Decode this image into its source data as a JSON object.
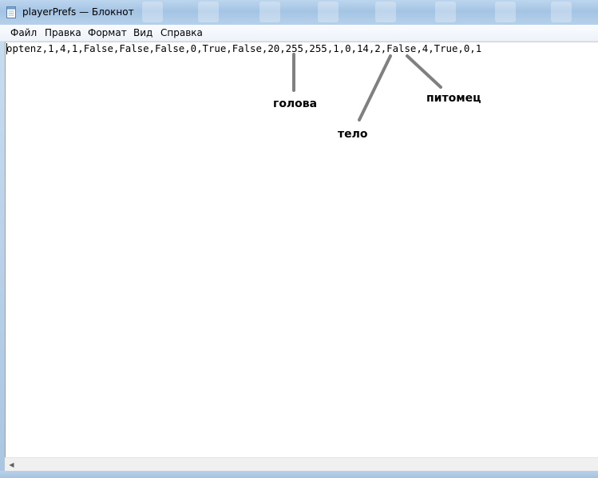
{
  "window": {
    "title": "playerPrefs — Блокнот",
    "icon": "notepad-icon"
  },
  "menu": {
    "items": [
      "Файл",
      "Правка",
      "Формат",
      "Вид",
      "Справка"
    ]
  },
  "editor": {
    "content": "optenz,1,4,1,False,False,False,0,True,False,20,255,255,1,0,14,2,False,4,True,0,1"
  },
  "annotations": {
    "head": "голова",
    "body": "тело",
    "pet": "питомец",
    "arrow_color": "#808080"
  },
  "scrollbar": {
    "left_arrow_icon": "scroll-left-arrow-icon"
  }
}
